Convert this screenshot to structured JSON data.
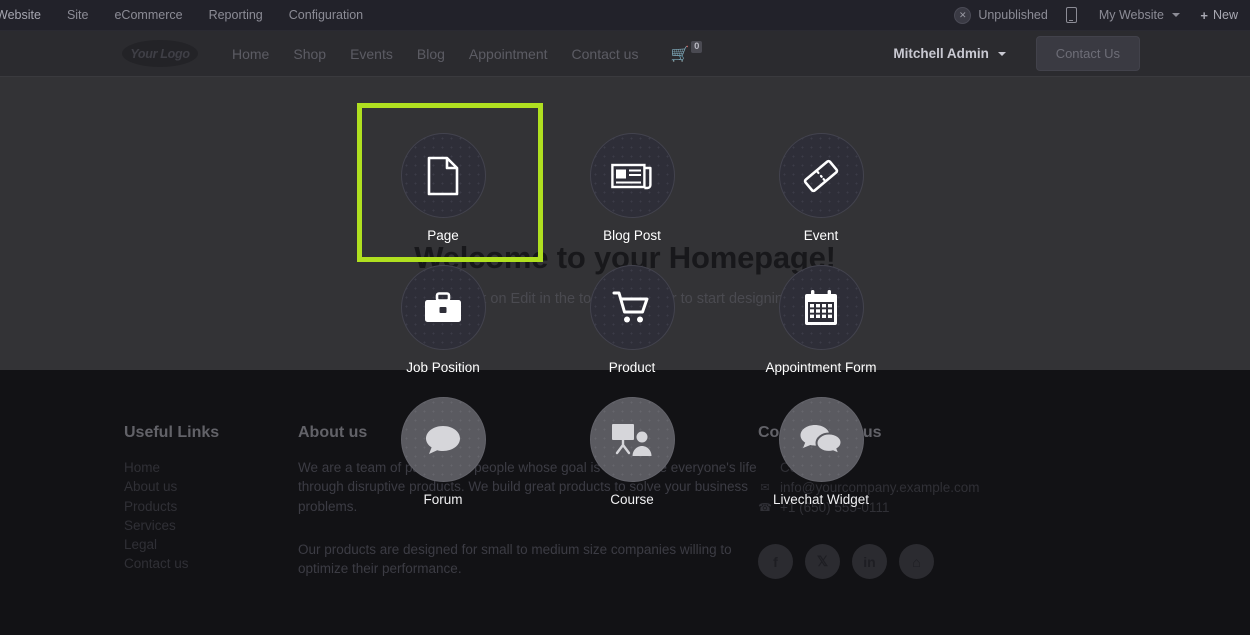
{
  "sysbar": {
    "brand": "Website",
    "menus": [
      "Site",
      "eCommerce",
      "Reporting",
      "Configuration"
    ],
    "publish_status": "Unpublished",
    "publish_icon": "toggle-off-icon",
    "mobile_preview_icon": "mobile-preview-icon",
    "website_selector": "My Website",
    "new_label": "New",
    "new_plus": "+"
  },
  "sitenav": {
    "logo_text": "Your Logo",
    "links": [
      "Home",
      "Shop",
      "Events",
      "Blog",
      "Appointment",
      "Contact us"
    ],
    "cart_icon": "shopping-cart-icon",
    "cart_count": "0",
    "user": "Mitchell Admin",
    "cta_label": "Contact Us"
  },
  "hero": {
    "title": "Welcome to your Homepage!",
    "subtitle": "Click on Edit in the top right corner to start designing."
  },
  "new_content": {
    "tiles": [
      {
        "label": "Page",
        "icon": "file-document-icon",
        "style": "dark",
        "selected": true
      },
      {
        "label": "Blog Post",
        "icon": "newspaper-icon",
        "style": "dark",
        "selected": false
      },
      {
        "label": "Event",
        "icon": "ticket-icon",
        "style": "dark",
        "selected": false
      },
      {
        "label": "Job Position",
        "icon": "briefcase-icon",
        "style": "dark",
        "selected": false
      },
      {
        "label": "Product",
        "icon": "shopping-cart-icon",
        "style": "dark",
        "selected": false
      },
      {
        "label": "Appointment Form",
        "icon": "calendar-icon",
        "style": "dark",
        "selected": false
      },
      {
        "label": "Forum",
        "icon": "chat-bubble-icon",
        "style": "light",
        "selected": false
      },
      {
        "label": "Course",
        "icon": "presentation-teacher-icon",
        "style": "light",
        "selected": false
      },
      {
        "label": "Livechat Widget",
        "icon": "chat-bubbles-icon",
        "style": "light",
        "selected": false
      }
    ],
    "highlight_color": "#b0e020"
  },
  "footer": {
    "links_title": "Useful Links",
    "links": [
      "Home",
      "About us",
      "Products",
      "Services",
      "Legal",
      "Contact us"
    ],
    "about_title": "About us",
    "about_p1": "We are a team of passionate people whose goal is to improve everyone's life through disruptive products. We build great products to solve your business problems.",
    "about_p2": "Our products are designed for small to medium size companies willing to optimize their performance.",
    "connect_title": "Connect with us",
    "contact_link": "Contact us",
    "email": "info@yourcompany.example.com",
    "email_icon": "envelope-icon",
    "phone": "+1 (650) 555-0111",
    "phone_icon": "phone-icon",
    "socials": [
      {
        "name": "facebook-icon",
        "glyph": "f"
      },
      {
        "name": "twitter-x-icon",
        "glyph": "𝕏"
      },
      {
        "name": "linkedin-icon",
        "glyph": "in"
      },
      {
        "name": "website-home-icon",
        "glyph": "⌂"
      }
    ]
  },
  "colors": {
    "highlight": "#b0e020",
    "hero_bg": "#333336",
    "footer_bg": "#121215",
    "sysbar_bg": "#22222a",
    "navbar_bg": "#2b2b2f"
  }
}
